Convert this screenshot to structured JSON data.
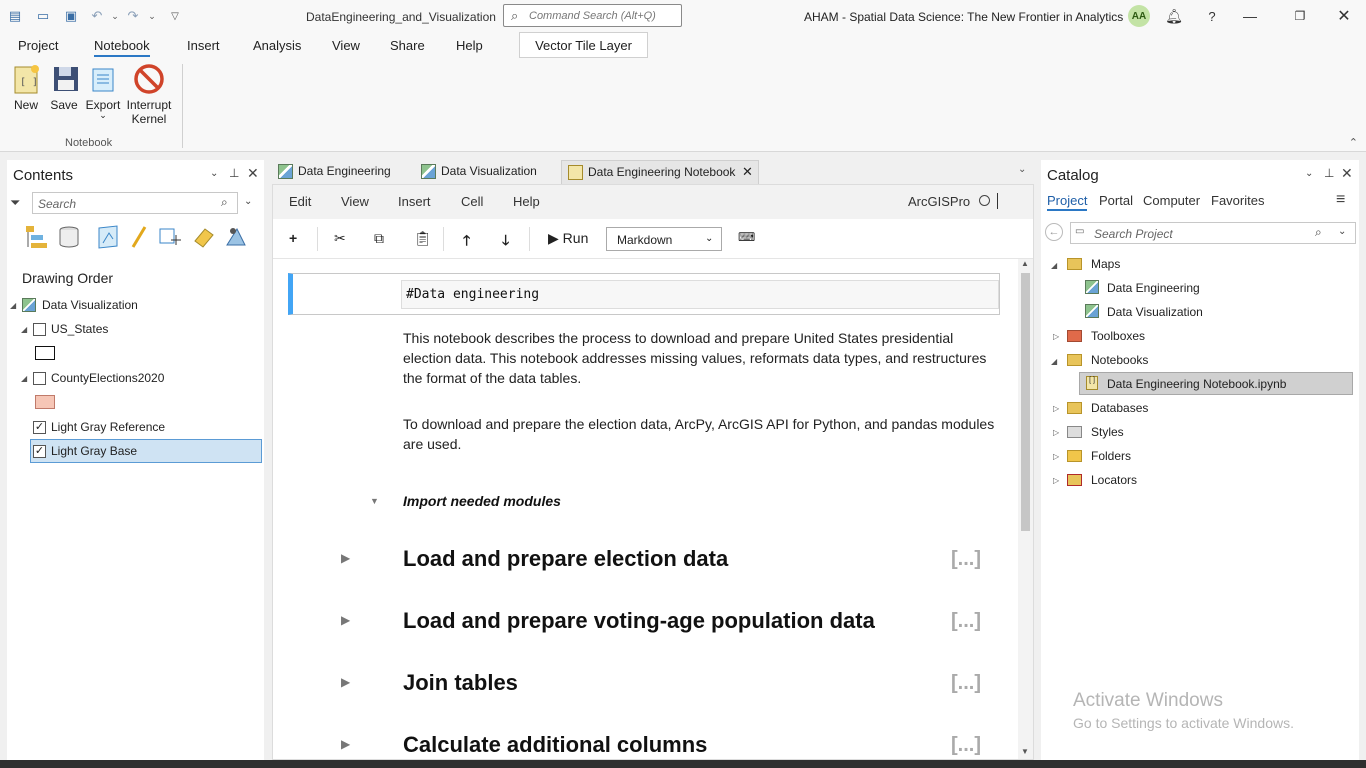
{
  "window": {
    "document_title": "DataEngineering_and_Visualization",
    "command_search_placeholder": "Command Search (Alt+Q)",
    "project_title": "AHAM - Spatial Data Science:  The New Frontier in Analytics",
    "user_initials": "AA"
  },
  "ribbon": {
    "tabs": [
      "Project",
      "Notebook",
      "Insert",
      "Analysis",
      "View",
      "Share",
      "Help"
    ],
    "active_tab": "Notebook",
    "contextual_tab": "Vector Tile Layer",
    "buttons": {
      "new": "New",
      "save": "Save",
      "export": "Export",
      "interrupt_line1": "Interrupt",
      "interrupt_line2": "Kernel"
    },
    "group_label": "Notebook"
  },
  "contents": {
    "title": "Contents",
    "search_placeholder": "Search",
    "drawing_order": "Drawing Order",
    "map": "Data Visualization",
    "layers": [
      {
        "name": "US_States",
        "checked": false
      },
      {
        "name": "CountyElections2020",
        "checked": false
      },
      {
        "name": "Light Gray Reference",
        "checked": true
      },
      {
        "name": "Light Gray Base",
        "checked": true
      }
    ]
  },
  "doc_tabs": [
    "Data Engineering",
    "Data Visualization",
    "Data Engineering Notebook"
  ],
  "notebook": {
    "menu": [
      "Edit",
      "View",
      "Insert",
      "Cell",
      "Help"
    ],
    "kernel": "ArcGISPro",
    "run_label": "Run",
    "cell_type": "Markdown",
    "markdown_source": "#Data engineering",
    "para1": "This notebook describes the process to download and prepare United States presidential election data. This notebook addresses missing values, reformats data types, and restructures the format of the data tables.",
    "para2": "To download and prepare the election data, ArcPy, ArcGIS API for Python, and pandas modules are used.",
    "subheading": "Import needed modules",
    "sections": [
      "Load and prepare election data",
      "Load and prepare voting-age population data",
      "Join tables",
      "Calculate additional columns"
    ],
    "collapsed_marker": "[...]"
  },
  "catalog": {
    "title": "Catalog",
    "tabs": [
      "Project",
      "Portal",
      "Computer",
      "Favorites"
    ],
    "search_placeholder": "Search Project",
    "maps": "Maps",
    "map_items": [
      "Data Engineering",
      "Data Visualization"
    ],
    "toolboxes": "Toolboxes",
    "notebooks": "Notebooks",
    "notebook_item": "Data Engineering Notebook.ipynb",
    "databases": "Databases",
    "styles": "Styles",
    "folders": "Folders",
    "locators": "Locators"
  },
  "watermark": {
    "line1": "Activate Windows",
    "line2": "Go to Settings to activate Windows."
  }
}
